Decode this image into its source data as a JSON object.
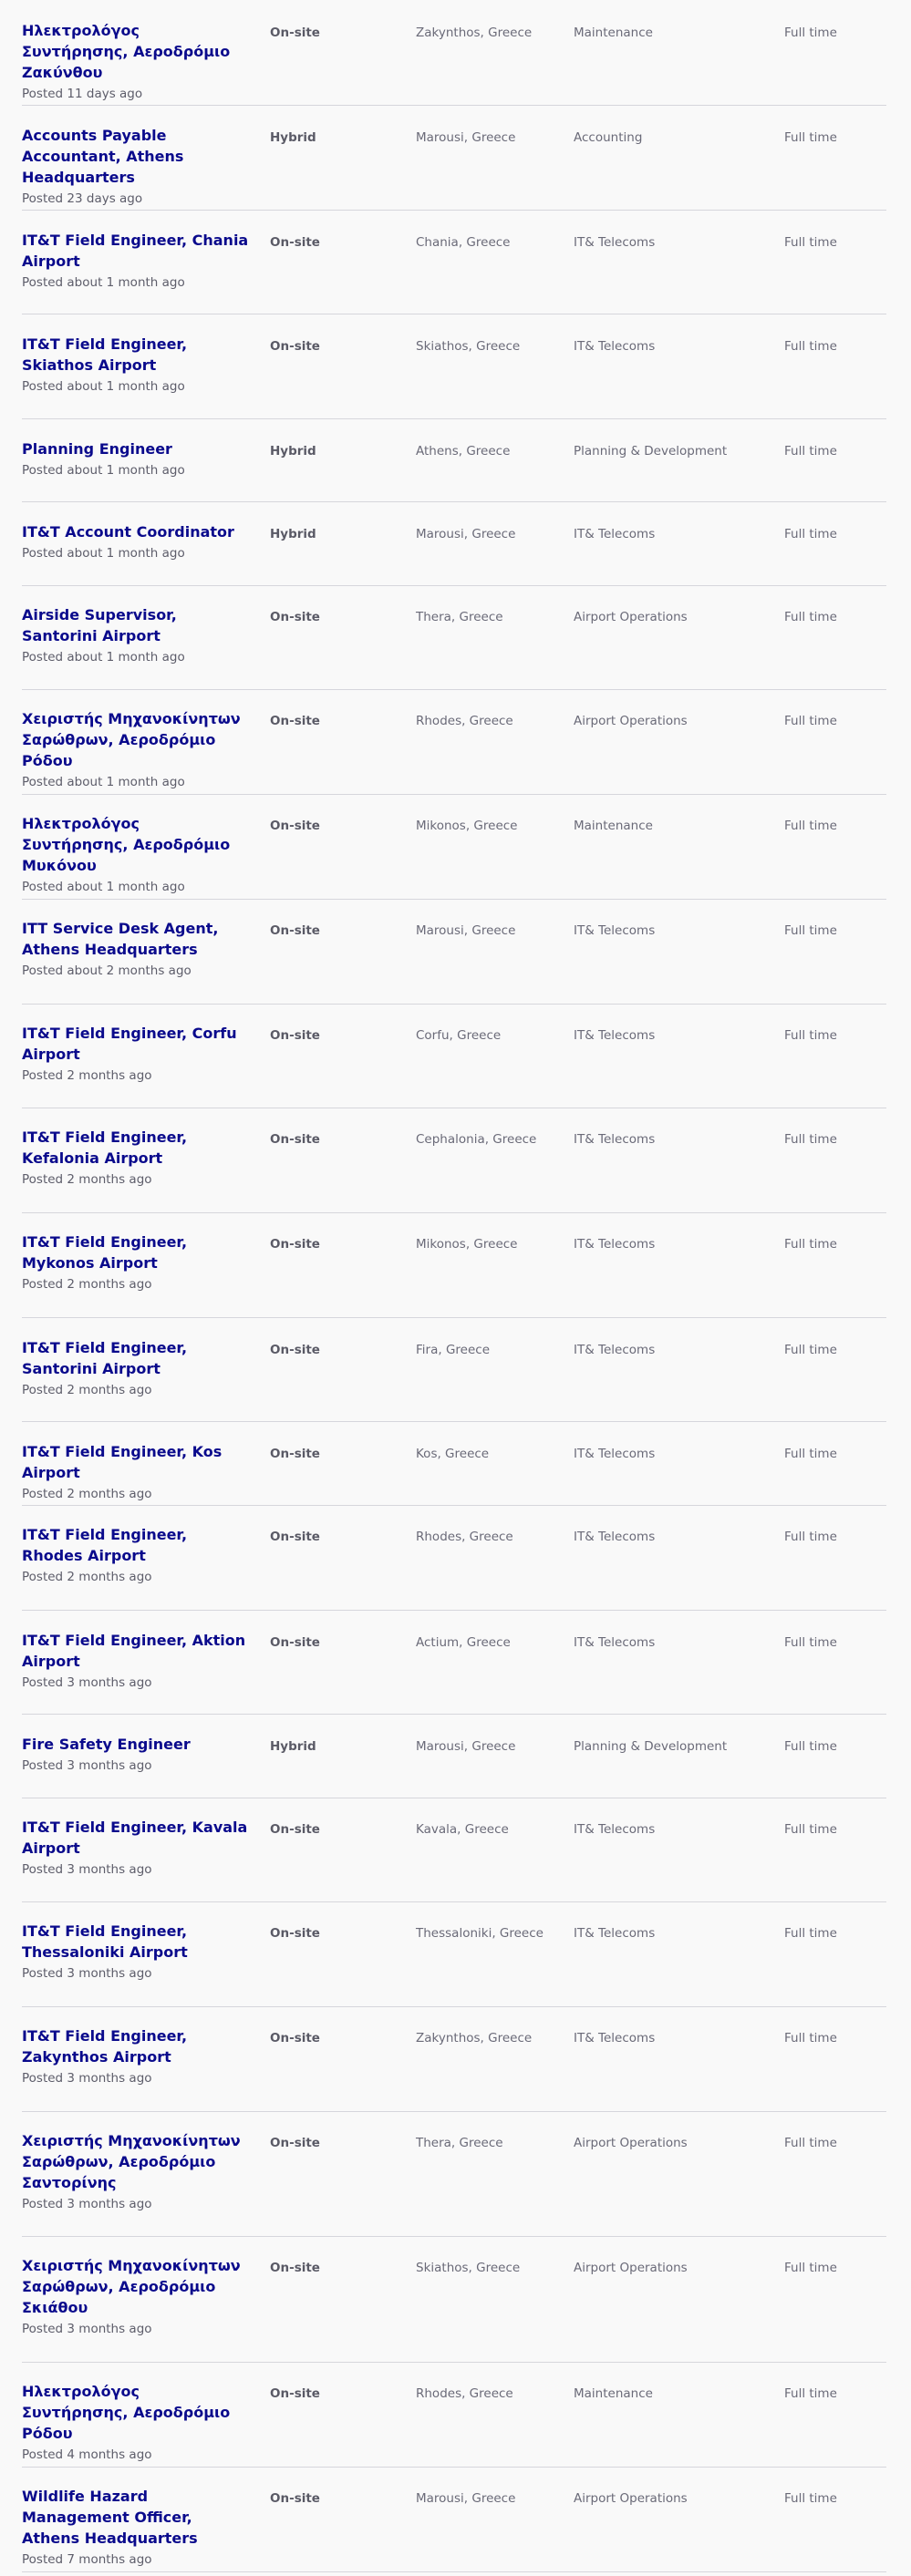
{
  "jobs": [
    {
      "title": "Ηλεκτρολόγος Συντήρησης, Αεροδρόμιο Ζακύνθου",
      "posted": "Posted 11 days ago",
      "workplace": "On-site",
      "location": "Zakynthos, Greece",
      "department": "Maintenance",
      "type": "Full time"
    },
    {
      "title": "Accounts Payable Accountant, Athens Headquarters",
      "posted": "Posted 23 days ago",
      "workplace": "Hybrid",
      "location": "Marousi, Greece",
      "department": "Accounting",
      "type": "Full time"
    },
    {
      "title": "IT&T Field Engineer, Chania Airport",
      "posted": "Posted about 1 month ago",
      "workplace": "On-site",
      "location": "Chania, Greece",
      "department": "IT& Telecoms",
      "type": "Full time"
    },
    {
      "title": "IT&T Field Engineer, Skiathos Airport",
      "posted": "Posted about 1 month ago",
      "workplace": "On-site",
      "location": "Skiathos, Greece",
      "department": "IT& Telecoms",
      "type": "Full time"
    },
    {
      "title": "Planning Engineer",
      "posted": "Posted about 1 month ago",
      "workplace": "Hybrid",
      "location": "Athens, Greece",
      "department": "Planning & Development",
      "type": "Full time"
    },
    {
      "title": "IT&T Account Coordinator",
      "posted": "Posted about 1 month ago",
      "workplace": "Hybrid",
      "location": "Marousi, Greece",
      "department": "IT& Telecoms",
      "type": "Full time"
    },
    {
      "title": "Airside Supervisor, Santorini Airport",
      "posted": "Posted about 1 month ago",
      "workplace": "On-site",
      "location": "Thera, Greece",
      "department": "Airport Operations",
      "type": "Full time"
    },
    {
      "title": "Χειριστής Μηχανοκίνητων Σαρώθρων, Αεροδρόμιο Ρόδου",
      "posted": "Posted about 1 month ago",
      "workplace": "On-site",
      "location": "Rhodes, Greece",
      "department": "Airport Operations",
      "type": "Full time"
    },
    {
      "title": "Ηλεκτρολόγος Συντήρησης, Αεροδρόμιο Μυκόνου",
      "posted": "Posted about 1 month ago",
      "workplace": "On-site",
      "location": "Mikonos, Greece",
      "department": "Maintenance",
      "type": "Full time"
    },
    {
      "title": "ITT Service Desk Agent, Athens Headquarters",
      "posted": "Posted about 2 months ago",
      "workplace": "On-site",
      "location": "Marousi, Greece",
      "department": "IT& Telecoms",
      "type": "Full time"
    },
    {
      "title": "IT&T Field Engineer, Corfu Airport",
      "posted": "Posted 2 months ago",
      "workplace": "On-site",
      "location": "Corfu, Greece",
      "department": "IT& Telecoms",
      "type": "Full time"
    },
    {
      "title": "IT&T Field Engineer, Kefalonia Airport",
      "posted": "Posted 2 months ago",
      "workplace": "On-site",
      "location": "Cephalonia, Greece",
      "department": "IT& Telecoms",
      "type": "Full time"
    },
    {
      "title": "IT&T Field Engineer, Mykonos Airport",
      "posted": "Posted 2 months ago",
      "workplace": "On-site",
      "location": "Mikonos, Greece",
      "department": "IT& Telecoms",
      "type": "Full time"
    },
    {
      "title": "IT&T Field Engineer, Santorini Airport",
      "posted": "Posted 2 months ago",
      "workplace": "On-site",
      "location": "Fira, Greece",
      "department": "IT& Telecoms",
      "type": "Full time"
    },
    {
      "title": "IT&T Field Engineer, Kos Airport",
      "posted": "Posted 2 months ago",
      "workplace": "On-site",
      "location": "Kos, Greece",
      "department": "IT& Telecoms",
      "type": "Full time"
    },
    {
      "title": "IT&T Field Engineer, Rhodes Airport",
      "posted": "Posted 2 months ago",
      "workplace": "On-site",
      "location": "Rhodes, Greece",
      "department": "IT& Telecoms",
      "type": "Full time"
    },
    {
      "title": "IT&T Field Engineer, Aktion Airport",
      "posted": "Posted 3 months ago",
      "workplace": "On-site",
      "location": "Actium, Greece",
      "department": "IT& Telecoms",
      "type": "Full time"
    },
    {
      "title": "Fire Safety Engineer",
      "posted": "Posted 3 months ago",
      "workplace": "Hybrid",
      "location": "Marousi, Greece",
      "department": "Planning & Development",
      "type": "Full time"
    },
    {
      "title": "IT&T Field Engineer, Kavala Airport",
      "posted": "Posted 3 months ago",
      "workplace": "On-site",
      "location": "Kavala, Greece",
      "department": "IT& Telecoms",
      "type": "Full time"
    },
    {
      "title": "IT&T Field Engineer, Thessaloniki Airport",
      "posted": "Posted 3 months ago",
      "workplace": "On-site",
      "location": "Thessaloniki, Greece",
      "department": "IT& Telecoms",
      "type": "Full time"
    },
    {
      "title": "IT&T Field Engineer, Zakynthos Airport",
      "posted": "Posted 3 months ago",
      "workplace": "On-site",
      "location": "Zakynthos, Greece",
      "department": "IT& Telecoms",
      "type": "Full time"
    },
    {
      "title": "Χειριστής Μηχανοκίνητων Σαρώθρων, Αεροδρόμιο Σαντορίνης",
      "posted": "Posted 3 months ago",
      "workplace": "On-site",
      "location": "Thera, Greece",
      "department": "Airport Operations",
      "type": "Full time"
    },
    {
      "title": "Χειριστής Μηχανοκίνητων Σαρώθρων, Αεροδρόμιο Σκιάθου",
      "posted": "Posted 3 months ago",
      "workplace": "On-site",
      "location": "Skiathos, Greece",
      "department": "Airport Operations",
      "type": "Full time"
    },
    {
      "title": "Ηλεκτρολόγος Συντήρησης, Αεροδρόμιο Ρόδου",
      "posted": "Posted 4 months ago",
      "workplace": "On-site",
      "location": "Rhodes, Greece",
      "department": "Maintenance",
      "type": "Full time"
    },
    {
      "title": "Wildlife Hazard Management Officer, Athens Headquarters",
      "posted": "Posted 7 months ago",
      "workplace": "On-site",
      "location": "Marousi, Greece",
      "department": "Airport Operations",
      "type": "Full time"
    }
  ]
}
